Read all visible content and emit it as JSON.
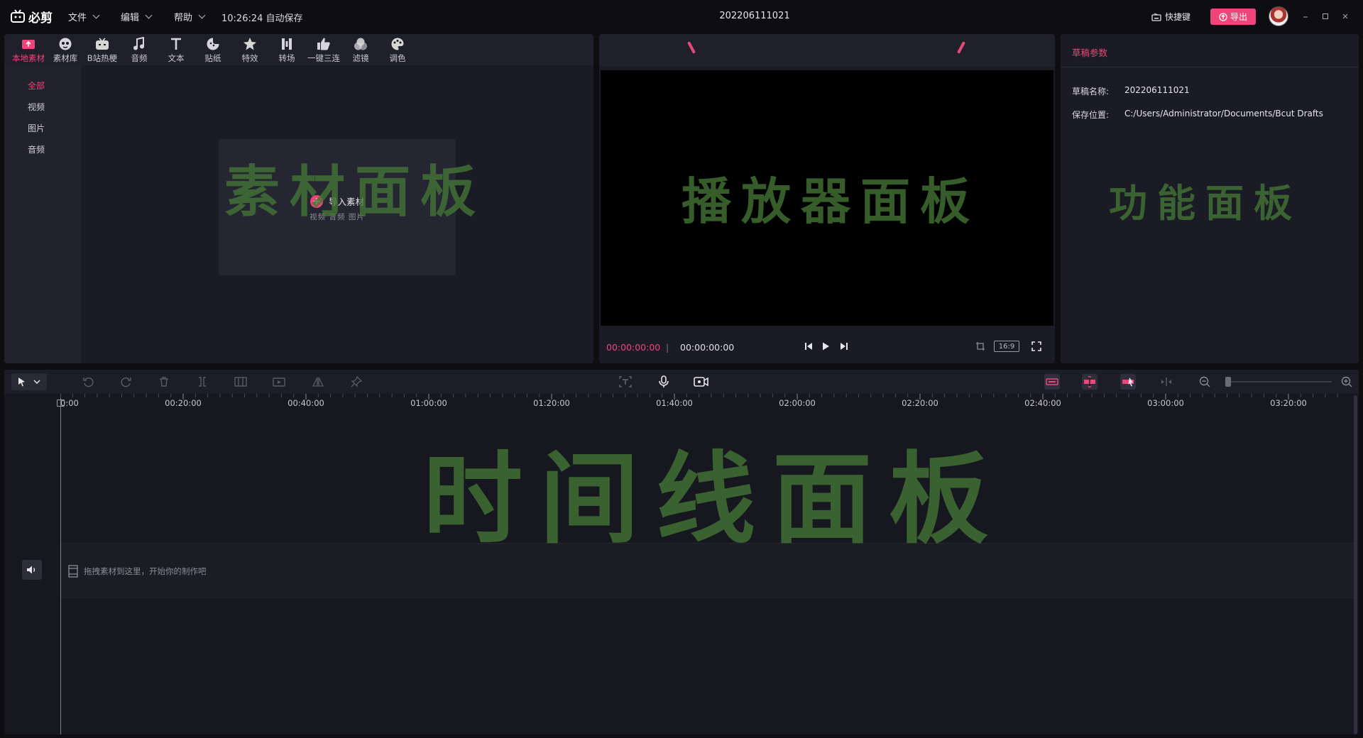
{
  "app": {
    "name": "必剪",
    "menus": [
      {
        "label": "文件"
      },
      {
        "label": "编辑"
      },
      {
        "label": "帮助"
      }
    ],
    "autosave": "10:26:24 自动保存",
    "doc_title": "202206111021",
    "shortcut_label": "快捷键",
    "export_label": "导出",
    "accent_color": "#f0457a",
    "window_controls": [
      "minimize-icon",
      "maximize-icon",
      "close-icon"
    ]
  },
  "material_panel": {
    "tabs": [
      {
        "label": "本地素材",
        "icon": "upload-icon",
        "active": true
      },
      {
        "label": "素材库",
        "icon": "face-icon"
      },
      {
        "label": "B站热梗",
        "icon": "tv-icon"
      },
      {
        "label": "音频",
        "icon": "music-note-icon"
      },
      {
        "label": "文本",
        "icon": "text-t-icon"
      },
      {
        "label": "贴纸",
        "icon": "sticker-icon"
      },
      {
        "label": "特效",
        "icon": "star-icon"
      },
      {
        "label": "转场",
        "icon": "transition-icon"
      },
      {
        "label": "一键三连",
        "icon": "thumbs-up-icon"
      },
      {
        "label": "滤镜",
        "icon": "filter-icon"
      },
      {
        "label": "调色",
        "icon": "palette-icon"
      }
    ],
    "sidebar": [
      {
        "label": "全部",
        "active": true
      },
      {
        "label": "视频"
      },
      {
        "label": "图片"
      },
      {
        "label": "音频"
      }
    ],
    "import_label": "导入素材",
    "import_types": "视频 音频 图片",
    "watermark": "素材面板"
  },
  "player_panel": {
    "current_time": "00:00:00:00",
    "separator": "|",
    "total_time": "00:00:00:00",
    "aspect_ratio": "16:9",
    "watermark": "播放器面板"
  },
  "function_panel": {
    "title": "草稿参数",
    "fields": [
      {
        "label": "草稿名称:",
        "value": "202206111021"
      },
      {
        "label": "保存位置:",
        "value": "C:/Users/Administrator/Documents/Bcut Drafts"
      }
    ],
    "watermark": "功能面板"
  },
  "timeline": {
    "ticks": [
      "00:00:00",
      "00:20:00",
      "00:40:00",
      "01:00:00",
      "01:20:00",
      "01:40:00",
      "02:00:00",
      "02:20:00",
      "02:40:00",
      "03:00:00",
      "03:20:00"
    ],
    "empty_hint": "拖拽素材到这里，开始你的制作吧",
    "watermark": "时间线面板"
  }
}
